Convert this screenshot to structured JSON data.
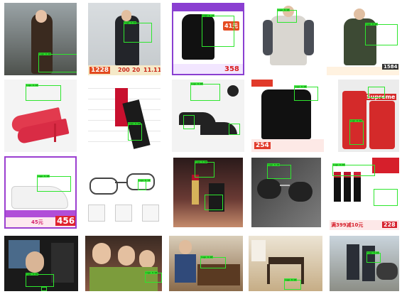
{
  "tiles": [
    {
      "id": "woman-street",
      "row": 0,
      "col": 0,
      "banner": ""
    },
    {
      "id": "man-store-promo",
      "row": 0,
      "col": 1,
      "banner": "1228",
      "banner2": "200",
      "banner3": "20",
      "banner4": "11.11"
    },
    {
      "id": "black-hoodie",
      "row": 0,
      "col": 2,
      "banner": "41元",
      "banner2": "358"
    },
    {
      "id": "raglan-tee",
      "row": 0,
      "col": 3,
      "banner": ""
    },
    {
      "id": "olive-jacket",
      "row": 0,
      "col": 4,
      "banner": "1584"
    },
    {
      "id": "red-heels",
      "row": 1,
      "col": 0,
      "banner": ""
    },
    {
      "id": "red-lipstick-box",
      "row": 1,
      "col": 1,
      "banner": ""
    },
    {
      "id": "converse-sneakers",
      "row": 1,
      "col": 2,
      "banner": ""
    },
    {
      "id": "black-zip-jacket",
      "row": 1,
      "col": 3,
      "banner": "254"
    },
    {
      "id": "supreme-luggage",
      "row": 1,
      "col": 4,
      "banner": "Supreme"
    },
    {
      "id": "white-sneaker-promo",
      "row": 2,
      "col": 0,
      "banner": "456",
      "banner2": "45元"
    },
    {
      "id": "eyeglasses",
      "row": 2,
      "col": 1,
      "banner": ""
    },
    {
      "id": "ysl-lipstick",
      "row": 2,
      "col": 2,
      "banner": ""
    },
    {
      "id": "aviator-sunglasses",
      "row": 2,
      "col": 3,
      "banner": ""
    },
    {
      "id": "dior-lipsticks-promo",
      "row": 2,
      "col": 4,
      "banner": "228",
      "banner2": "满399减10元"
    },
    {
      "id": "tv-screen-man",
      "row": 3,
      "col": 0,
      "banner": ""
    },
    {
      "id": "three-women",
      "row": 3,
      "col": 1,
      "banner": ""
    },
    {
      "id": "dining-people",
      "row": 3,
      "col": 2,
      "banner": ""
    },
    {
      "id": "dining-room",
      "row": 3,
      "col": 3,
      "banner": ""
    },
    {
      "id": "motorcycle-riders",
      "row": 3,
      "col": 4,
      "banner": ""
    }
  ],
  "detection_label": "logo 0.98"
}
